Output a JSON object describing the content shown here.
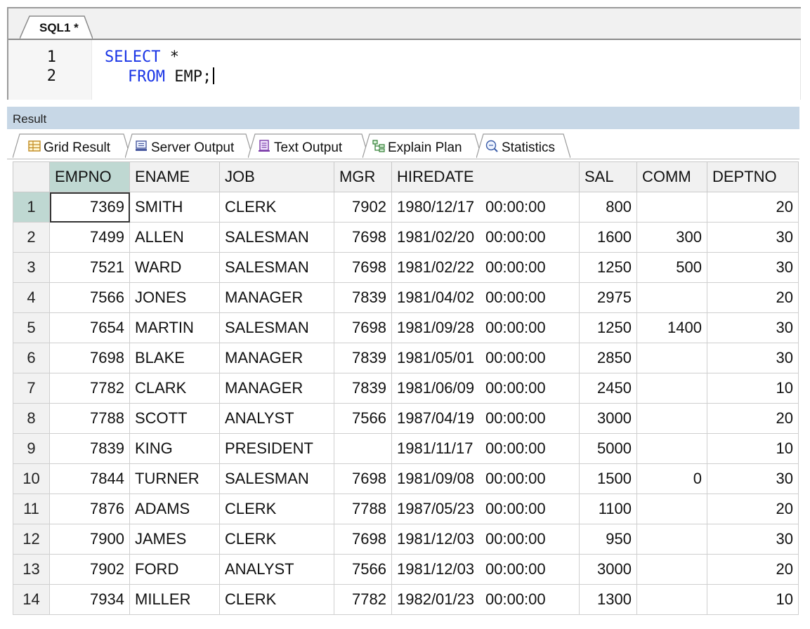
{
  "editor": {
    "tab_label": "SQL1 *",
    "lines": [
      {
        "number": "1",
        "keyword": "SELECT",
        "rest": " *"
      },
      {
        "number": "2",
        "keyword": "FROM",
        "rest": " EMP;"
      }
    ]
  },
  "result": {
    "header_label": "Result",
    "tabs": [
      {
        "label": "Grid Result",
        "icon": "grid-icon"
      },
      {
        "label": "Server Output",
        "icon": "server-output-icon"
      },
      {
        "label": "Text Output",
        "icon": "text-output-icon"
      },
      {
        "label": "Explain Plan",
        "icon": "explain-plan-icon"
      },
      {
        "label": "Statistics",
        "icon": "statistics-icon"
      }
    ],
    "columns": [
      "EMPNO",
      "ENAME",
      "JOB",
      "MGR",
      "HIREDATE",
      "SAL",
      "COMM",
      "DEPTNO"
    ],
    "rows": [
      [
        "7369",
        "SMITH",
        "CLERK",
        "7902",
        "1980/12/17",
        "00:00:00",
        "800",
        "",
        "20"
      ],
      [
        "7499",
        "ALLEN",
        "SALESMAN",
        "7698",
        "1981/02/20",
        "00:00:00",
        "1600",
        "300",
        "30"
      ],
      [
        "7521",
        "WARD",
        "SALESMAN",
        "7698",
        "1981/02/22",
        "00:00:00",
        "1250",
        "500",
        "30"
      ],
      [
        "7566",
        "JONES",
        "MANAGER",
        "7839",
        "1981/04/02",
        "00:00:00",
        "2975",
        "",
        "20"
      ],
      [
        "7654",
        "MARTIN",
        "SALESMAN",
        "7698",
        "1981/09/28",
        "00:00:00",
        "1250",
        "1400",
        "30"
      ],
      [
        "7698",
        "BLAKE",
        "MANAGER",
        "7839",
        "1981/05/01",
        "00:00:00",
        "2850",
        "",
        "30"
      ],
      [
        "7782",
        "CLARK",
        "MANAGER",
        "7839",
        "1981/06/09",
        "00:00:00",
        "2450",
        "",
        "10"
      ],
      [
        "7788",
        "SCOTT",
        "ANALYST",
        "7566",
        "1987/04/19",
        "00:00:00",
        "3000",
        "",
        "20"
      ],
      [
        "7839",
        "KING",
        "PRESIDENT",
        "",
        "1981/11/17",
        "00:00:00",
        "5000",
        "",
        "10"
      ],
      [
        "7844",
        "TURNER",
        "SALESMAN",
        "7698",
        "1981/09/08",
        "00:00:00",
        "1500",
        "0",
        "30"
      ],
      [
        "7876",
        "ADAMS",
        "CLERK",
        "7788",
        "1987/05/23",
        "00:00:00",
        "1100",
        "",
        "20"
      ],
      [
        "7900",
        "JAMES",
        "CLERK",
        "7698",
        "1981/12/03",
        "00:00:00",
        "950",
        "",
        "30"
      ],
      [
        "7902",
        "FORD",
        "ANALYST",
        "7566",
        "1981/12/03",
        "00:00:00",
        "3000",
        "",
        "20"
      ],
      [
        "7934",
        "MILLER",
        "CLERK",
        "7782",
        "1982/01/23",
        "00:00:00",
        "1300",
        "",
        "10"
      ]
    ],
    "row_numbers": [
      "1",
      "2",
      "3",
      "4",
      "5",
      "6",
      "7",
      "8",
      "9",
      "10",
      "11",
      "12",
      "13",
      "14"
    ]
  },
  "colors": {
    "keyword": "#1a35e6",
    "selection": "#bfd8d2",
    "result_header": "#c7d7e6"
  }
}
